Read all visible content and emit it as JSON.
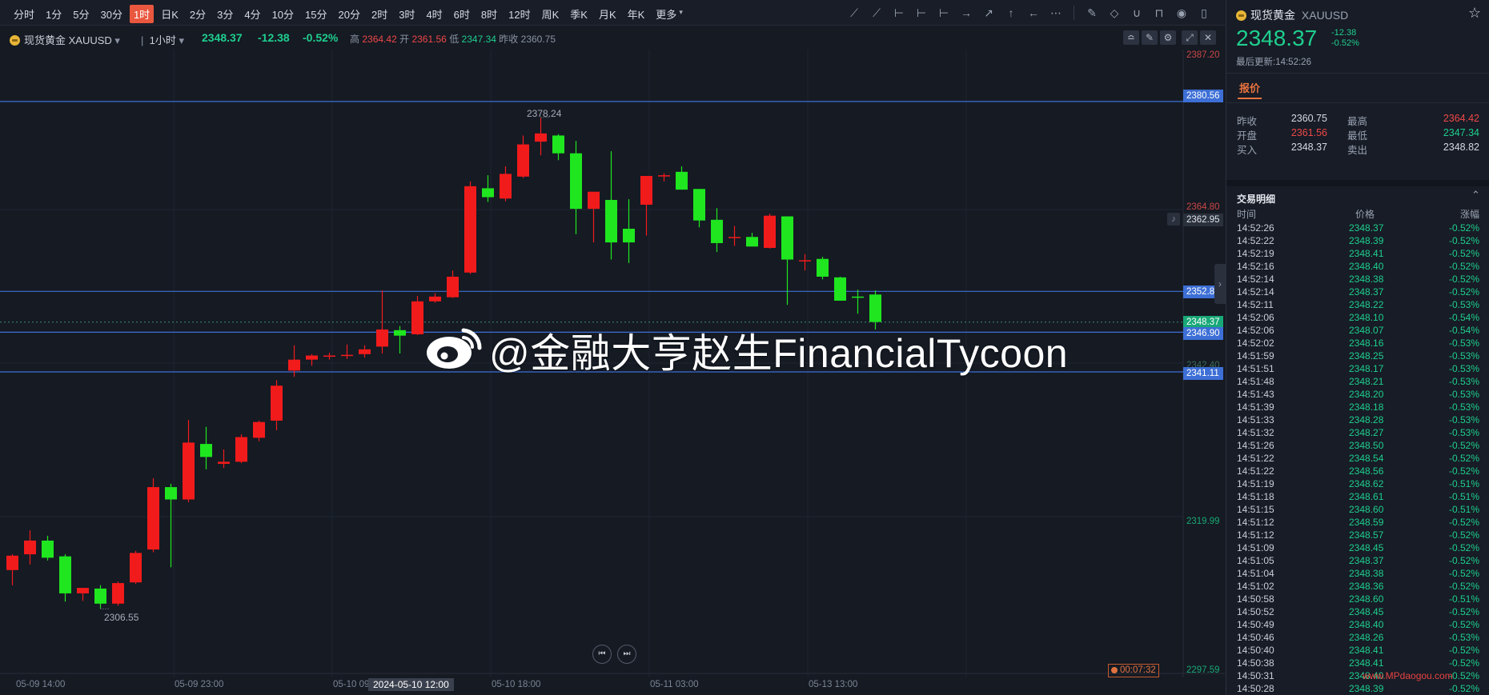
{
  "toolbar": {
    "timeframes": [
      "分时",
      "1分",
      "5分",
      "30分",
      "1时",
      "日K",
      "2分",
      "3分",
      "4分",
      "10分",
      "15分",
      "20分",
      "2时",
      "3时",
      "4时",
      "6时",
      "8时",
      "12时",
      "周K",
      "季K",
      "月K",
      "年K",
      "更多"
    ],
    "active": "1时"
  },
  "header": {
    "symbol": "现货黄金 XAUUSD",
    "interval": "1小时",
    "price": "2348.37",
    "change": "-12.38",
    "pct": "-0.52%",
    "high_label": "高",
    "high": "2364.42",
    "open_label": "开",
    "open": "2361.56",
    "low_label": "低",
    "low": "2347.34",
    "prev_label": "昨收",
    "prev": "2360.75"
  },
  "chart": {
    "y_axis_labels": [
      "2387.20",
      "2364.80",
      "2319.99",
      "2297.59"
    ],
    "hlines": [
      {
        "price": "2380.56",
        "color": "#3d6fd6"
      },
      {
        "price": "2352.86",
        "color": "#3d6fd6"
      },
      {
        "price": "2346.90",
        "color": "#3d6fd6"
      },
      {
        "price": "2341.11",
        "color": "#3d6fd6"
      }
    ],
    "current_price": "2348.37",
    "alert_price": "2362.95",
    "faded_price": "2342.40",
    "annot_high": "2378.24",
    "annot_low": "2306.55",
    "time_labels": [
      "05-09 14:00",
      "05-09 23:00",
      "05-10 09:00",
      "05-10 18:00",
      "05-11 03:00",
      "05-13 13:00"
    ],
    "crosshair_time": "2024-05-10 12:00",
    "countdown": "00:07:32"
  },
  "watermark": "@金融大亨赵生FinancialTycoon",
  "site_watermark": "www.MPdaogou.com",
  "panel": {
    "symbol": "现货黄金",
    "code": "XAUUSD",
    "price": "2348.37",
    "change": "-12.38",
    "pct": "-0.52%",
    "updated": "最后更新:14:52:26",
    "tab": "报价",
    "stats": [
      {
        "l1": "昨收",
        "v1": "2360.75",
        "c1": "#d5d9e1",
        "l2": "最高",
        "v2": "2364.42",
        "c2": "#f04848"
      },
      {
        "l1": "开盘",
        "v1": "2361.56",
        "c1": "#f04848",
        "l2": "最低",
        "v2": "2347.34",
        "c2": "#1fce8e"
      },
      {
        "l1": "买入",
        "v1": "2348.37",
        "c1": "#d5d9e1",
        "l2": "卖出",
        "v2": "2348.82",
        "c2": "#d5d9e1"
      }
    ],
    "trades_title": "交易明细",
    "col_time": "时间",
    "col_price": "价格",
    "col_change": "涨幅",
    "trades": [
      [
        "14:52:26",
        "2348.37",
        "-0.52%"
      ],
      [
        "14:52:22",
        "2348.39",
        "-0.52%"
      ],
      [
        "14:52:19",
        "2348.41",
        "-0.52%"
      ],
      [
        "14:52:16",
        "2348.40",
        "-0.52%"
      ],
      [
        "14:52:14",
        "2348.38",
        "-0.52%"
      ],
      [
        "14:52:14",
        "2348.37",
        "-0.52%"
      ],
      [
        "14:52:11",
        "2348.22",
        "-0.53%"
      ],
      [
        "14:52:06",
        "2348.10",
        "-0.54%"
      ],
      [
        "14:52:06",
        "2348.07",
        "-0.54%"
      ],
      [
        "14:52:02",
        "2348.16",
        "-0.53%"
      ],
      [
        "14:51:59",
        "2348.25",
        "-0.53%"
      ],
      [
        "14:51:51",
        "2348.17",
        "-0.53%"
      ],
      [
        "14:51:48",
        "2348.21",
        "-0.53%"
      ],
      [
        "14:51:43",
        "2348.20",
        "-0.53%"
      ],
      [
        "14:51:39",
        "2348.18",
        "-0.53%"
      ],
      [
        "14:51:33",
        "2348.28",
        "-0.53%"
      ],
      [
        "14:51:32",
        "2348.27",
        "-0.53%"
      ],
      [
        "14:51:26",
        "2348.50",
        "-0.52%"
      ],
      [
        "14:51:22",
        "2348.54",
        "-0.52%"
      ],
      [
        "14:51:22",
        "2348.56",
        "-0.52%"
      ],
      [
        "14:51:19",
        "2348.62",
        "-0.51%"
      ],
      [
        "14:51:18",
        "2348.61",
        "-0.51%"
      ],
      [
        "14:51:15",
        "2348.60",
        "-0.51%"
      ],
      [
        "14:51:12",
        "2348.59",
        "-0.52%"
      ],
      [
        "14:51:12",
        "2348.57",
        "-0.52%"
      ],
      [
        "14:51:09",
        "2348.45",
        "-0.52%"
      ],
      [
        "14:51:05",
        "2348.37",
        "-0.52%"
      ],
      [
        "14:51:04",
        "2348.38",
        "-0.52%"
      ],
      [
        "14:51:02",
        "2348.36",
        "-0.52%"
      ],
      [
        "14:50:58",
        "2348.60",
        "-0.51%"
      ],
      [
        "14:50:52",
        "2348.45",
        "-0.52%"
      ],
      [
        "14:50:49",
        "2348.40",
        "-0.52%"
      ],
      [
        "14:50:46",
        "2348.26",
        "-0.53%"
      ],
      [
        "14:50:40",
        "2348.41",
        "-0.52%"
      ],
      [
        "14:50:38",
        "2348.41",
        "-0.52%"
      ],
      [
        "14:50:31",
        "2348.40",
        "-0.52%"
      ],
      [
        "14:50:28",
        "2348.39",
        "-0.52%"
      ]
    ]
  },
  "chart_data": {
    "type": "candlestick",
    "interval": "1h",
    "candles": [
      {
        "o": 2312.2,
        "h": 2314.5,
        "l": 2310.0,
        "c": 2314.3
      },
      {
        "o": 2314.5,
        "h": 2318.0,
        "l": 2313.0,
        "c": 2316.5
      },
      {
        "o": 2316.5,
        "h": 2317.2,
        "l": 2313.6,
        "c": 2314.0
      },
      {
        "o": 2314.2,
        "h": 2314.5,
        "l": 2307.6,
        "c": 2308.8
      },
      {
        "o": 2308.8,
        "h": 2309.6,
        "l": 2307.7,
        "c": 2309.6
      },
      {
        "o": 2309.5,
        "h": 2310.0,
        "l": 2306.6,
        "c": 2307.3
      },
      {
        "o": 2307.3,
        "h": 2310.5,
        "l": 2307.0,
        "c": 2310.3
      },
      {
        "o": 2310.4,
        "h": 2315.0,
        "l": 2310.2,
        "c": 2314.7
      },
      {
        "o": 2315.2,
        "h": 2325.6,
        "l": 2314.8,
        "c": 2324.3
      },
      {
        "o": 2324.3,
        "h": 2324.8,
        "l": 2312.6,
        "c": 2322.5
      },
      {
        "o": 2322.5,
        "h": 2334.1,
        "l": 2322.1,
        "c": 2330.8
      },
      {
        "o": 2330.6,
        "h": 2333.1,
        "l": 2326.9,
        "c": 2328.7
      },
      {
        "o": 2327.7,
        "h": 2329.8,
        "l": 2327.1,
        "c": 2328.0
      },
      {
        "o": 2328.0,
        "h": 2332.0,
        "l": 2327.8,
        "c": 2331.6
      },
      {
        "o": 2331.5,
        "h": 2334.0,
        "l": 2331.0,
        "c": 2333.8
      },
      {
        "o": 2334.0,
        "h": 2339.9,
        "l": 2332.6,
        "c": 2339.1
      },
      {
        "o": 2341.3,
        "h": 2345.0,
        "l": 2340.4,
        "c": 2342.9
      },
      {
        "o": 2342.9,
        "h": 2343.7,
        "l": 2342.0,
        "c": 2343.5
      },
      {
        "o": 2343.4,
        "h": 2343.9,
        "l": 2342.9,
        "c": 2343.5
      },
      {
        "o": 2343.6,
        "h": 2345.1,
        "l": 2343.0,
        "c": 2343.6
      },
      {
        "o": 2343.7,
        "h": 2345.0,
        "l": 2343.2,
        "c": 2344.4
      },
      {
        "o": 2344.8,
        "h": 2353.0,
        "l": 2343.8,
        "c": 2347.3
      },
      {
        "o": 2347.2,
        "h": 2347.8,
        "l": 2343.8,
        "c": 2346.4
      },
      {
        "o": 2346.6,
        "h": 2352.2,
        "l": 2346.5,
        "c": 2351.4
      },
      {
        "o": 2351.4,
        "h": 2352.6,
        "l": 2351.2,
        "c": 2352.1
      },
      {
        "o": 2352.0,
        "h": 2355.9,
        "l": 2351.9,
        "c": 2355.0
      },
      {
        "o": 2355.6,
        "h": 2368.9,
        "l": 2355.4,
        "c": 2368.2
      },
      {
        "o": 2367.9,
        "h": 2369.8,
        "l": 2365.9,
        "c": 2366.6
      },
      {
        "o": 2366.4,
        "h": 2371.1,
        "l": 2366.0,
        "c": 2370.0
      },
      {
        "o": 2369.6,
        "h": 2375.6,
        "l": 2369.4,
        "c": 2374.3
      },
      {
        "o": 2374.7,
        "h": 2378.2,
        "l": 2372.7,
        "c": 2375.9
      },
      {
        "o": 2375.6,
        "h": 2375.8,
        "l": 2372.0,
        "c": 2373.0
      },
      {
        "o": 2373.0,
        "h": 2374.8,
        "l": 2361.2,
        "c": 2364.9
      },
      {
        "o": 2364.9,
        "h": 2366.6,
        "l": 2360.0,
        "c": 2367.4
      },
      {
        "o": 2366.2,
        "h": 2373.3,
        "l": 2357.5,
        "c": 2360.0
      },
      {
        "o": 2362.0,
        "h": 2366.3,
        "l": 2357.0,
        "c": 2360.0
      },
      {
        "o": 2365.5,
        "h": 2369.0,
        "l": 2361.0,
        "c": 2369.7
      },
      {
        "o": 2369.7,
        "h": 2370.1,
        "l": 2368.9,
        "c": 2369.8
      },
      {
        "o": 2370.3,
        "h": 2371.1,
        "l": 2367.7,
        "c": 2367.7
      },
      {
        "o": 2367.8,
        "h": 2367.8,
        "l": 2362.2,
        "c": 2363.2
      },
      {
        "o": 2363.3,
        "h": 2365.0,
        "l": 2358.6,
        "c": 2359.9
      },
      {
        "o": 2360.8,
        "h": 2362.4,
        "l": 2359.5,
        "c": 2360.8
      },
      {
        "o": 2360.8,
        "h": 2361.4,
        "l": 2360.0,
        "c": 2359.4
      },
      {
        "o": 2359.2,
        "h": 2364.2,
        "l": 2359.1,
        "c": 2363.9
      },
      {
        "o": 2363.8,
        "h": 2363.8,
        "l": 2350.9,
        "c": 2357.5
      },
      {
        "o": 2357.4,
        "h": 2358.3,
        "l": 2355.9,
        "c": 2357.4
      },
      {
        "o": 2357.6,
        "h": 2357.9,
        "l": 2354.6,
        "c": 2355.0
      },
      {
        "o": 2354.9,
        "h": 2355.0,
        "l": 2352.4,
        "c": 2351.5
      },
      {
        "o": 2352.1,
        "h": 2353.1,
        "l": 2349.6,
        "c": 2352.0
      },
      {
        "o": 2352.4,
        "h": 2353.0,
        "l": 2347.3,
        "c": 2348.4
      }
    ]
  }
}
